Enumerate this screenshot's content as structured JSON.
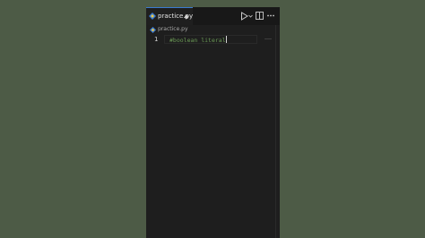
{
  "window": {
    "background_color": "#4d5b46",
    "editor_background": "#1e1e1e"
  },
  "tabs": [
    {
      "label": "practice.py",
      "icon": "python-icon",
      "unsaved": true,
      "active": true
    }
  ],
  "toolbar": {
    "run_icon": "play-icon",
    "run_menu_icon": "chevron-down-icon",
    "split_icon": "split-editor-icon",
    "more_icon": "ellipsis-icon"
  },
  "breadcrumb": {
    "icon": "python-icon",
    "file": "practice.py"
  },
  "editor": {
    "lines": [
      {
        "number": "1",
        "text_before_cursor": "#boolean literal",
        "comment_color": "#6a9955"
      }
    ]
  },
  "colors": {
    "tab_accent": "#3b7bd0",
    "python_blue": "#3b7bd0",
    "python_yellow": "#e8c547"
  }
}
